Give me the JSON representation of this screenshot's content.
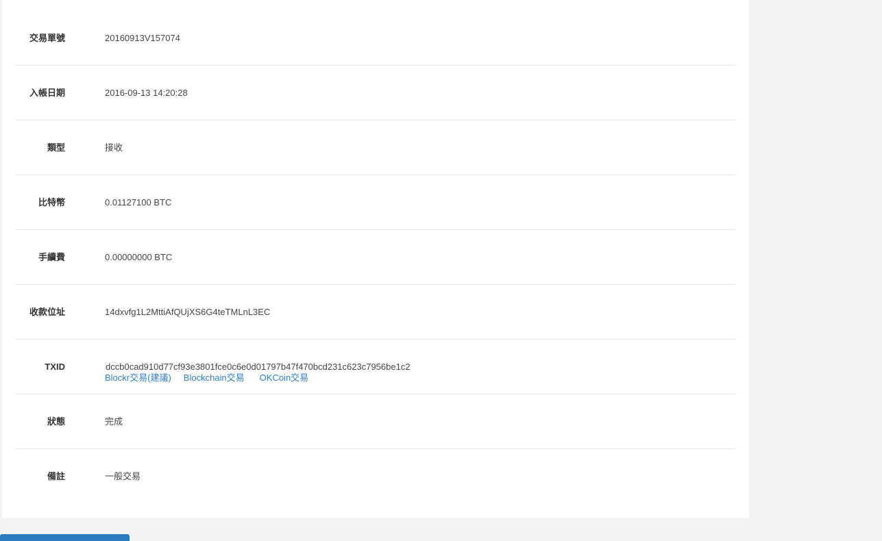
{
  "rows": [
    {
      "label": "交易單號",
      "value": "20160913V157074"
    },
    {
      "label": "入帳日期",
      "value": "2016-09-13 14:20:28"
    },
    {
      "label": "類型",
      "value": "接收"
    },
    {
      "label": "比特幣",
      "value": "0.01127100 BTC"
    },
    {
      "label": "手續費",
      "value": "0.00000000 BTC"
    },
    {
      "label": "收款位址",
      "value": "14dxvfg1L2MttiAfQUjXS6G4teTMLnL3EC"
    },
    {
      "label": "TXID",
      "value": "dccb0cad910d77cf93e3801fce0c6e0d01797b47f470bcd231c623c7956be1c2"
    },
    {
      "label": "狀態",
      "value": "完成"
    },
    {
      "label": "備註",
      "value": "一般交易"
    }
  ],
  "txid_links": {
    "blockr": "Blockr交易(建議)",
    "blockchain": "Blockchain交易",
    "okcoin": "OKCoin交易"
  },
  "colors": {
    "link": "#2f7dc4",
    "button": "#2b7bbf"
  }
}
